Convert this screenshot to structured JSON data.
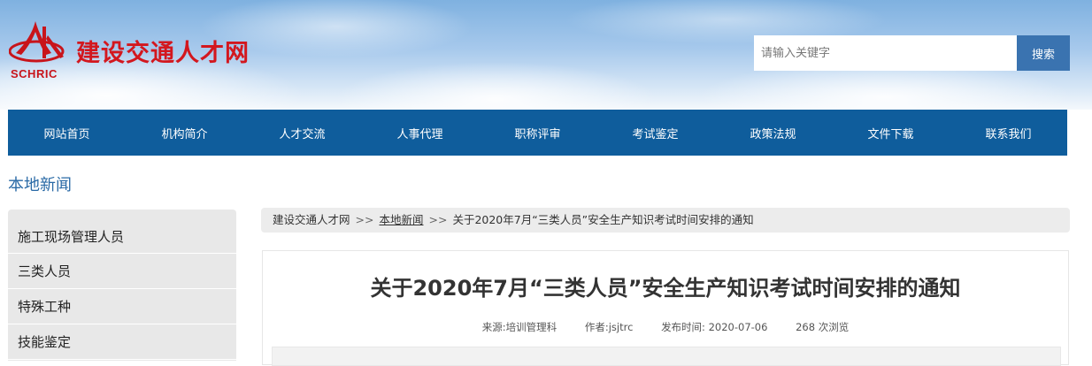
{
  "header": {
    "logo_cn": "建设交通人才网",
    "logo_en": "SCHRIC",
    "search_placeholder": "请输入关键字",
    "search_button": "搜索"
  },
  "nav": {
    "items": [
      "网站首页",
      "机构简介",
      "人才交流",
      "人事代理",
      "职称评审",
      "考试鉴定",
      "政策法规",
      "文件下载",
      "联系我们"
    ]
  },
  "section_title": "本地新闻",
  "sidebar": {
    "items": [
      "施工现场管理人员",
      "三类人员",
      "特殊工种",
      "技能鉴定"
    ]
  },
  "breadcrumb": {
    "home": "建设交通人才网",
    "separator": ">>",
    "category": "本地新闻",
    "current": "关于2020年7月“三类人员”安全生产知识考试时间安排的通知"
  },
  "article": {
    "title": "关于2020年7月“三类人员”安全生产知识考试时间安排的通知",
    "source": "来源:培训管理科",
    "author": "作者:jsjtrc",
    "published": "发布时间: 2020-07-06",
    "views": "268 次浏览"
  },
  "colors": {
    "brand_red": "#d3171e",
    "nav_blue": "#0f5d9c",
    "search_button": "#3a73b0"
  }
}
